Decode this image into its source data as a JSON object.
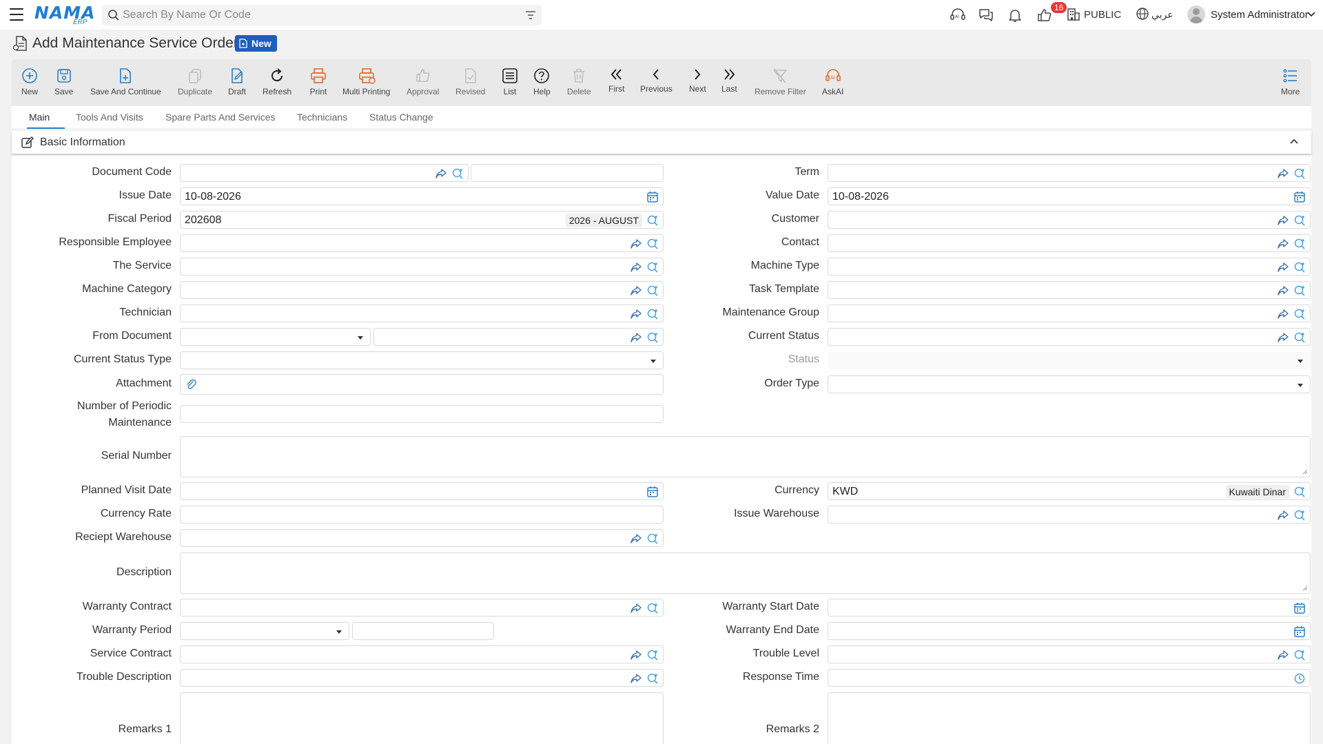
{
  "topbar": {
    "logo_text": "NAMA",
    "logo_sub": "ERP",
    "search_placeholder": "Search By Name Or Code",
    "notification_count": "16",
    "public_label": "PUBLIC",
    "language_label": "عربي",
    "user_name": "System Administrator"
  },
  "page": {
    "title": "Add Maintenance Service Order",
    "status_badge": "New"
  },
  "toolbar": {
    "new": "New",
    "save": "Save",
    "save_continue": "Save And Continue",
    "duplicate": "Duplicate",
    "draft": "Draft",
    "refresh": "Refresh",
    "print": "Print",
    "multi_printing": "Multi Printing",
    "approval": "Approval",
    "revised": "Revised",
    "list": "List",
    "help": "Help",
    "delete": "Delete",
    "first": "First",
    "previous": "Previous",
    "next": "Next",
    "last": "Last",
    "remove_filter": "Remove Filter",
    "askai": "AskAI",
    "more": "More"
  },
  "tabs": [
    "Main",
    "Tools And Visits",
    "Spare Parts And Services",
    "Technicians",
    "Status Change"
  ],
  "section": {
    "title": "Basic Information"
  },
  "form": {
    "labels": {
      "document_code": "Document Code",
      "issue_date": "Issue Date",
      "fiscal_period": "Fiscal Period",
      "responsible_employee": "Responsible Employee",
      "the_service": "The Service",
      "machine_category": "Machine Category",
      "technician": "Technician",
      "from_document": "From Document",
      "current_status_type": "Current Status Type",
      "attachment": "Attachment",
      "number_periodic_1": "Number of Periodic",
      "number_periodic_2": "Maintenance",
      "serial_number": "Serial Number",
      "planned_visit_date": "Planned Visit Date",
      "currency_rate": "Currency Rate",
      "receipt_warehouse": "Reciept Warehouse",
      "description": "Description",
      "warranty_contract": "Warranty Contract",
      "warranty_period": "Warranty Period",
      "service_contract": "Service Contract",
      "trouble_description": "Trouble Description",
      "remarks1": "Remarks 1",
      "term": "Term",
      "value_date": "Value Date",
      "customer": "Customer",
      "contact": "Contact",
      "machine_type": "Machine Type",
      "task_template": "Task Template",
      "maintenance_group": "Maintenance Group",
      "current_status": "Current Status",
      "status": "Status",
      "order_type": "Order Type",
      "currency": "Currency",
      "issue_warehouse": "Issue Warehouse",
      "warranty_start_date": "Warranty Start Date",
      "warranty_end_date": "Warranty End Date",
      "trouble_level": "Trouble Level",
      "response_time": "Response Time",
      "remarks2": "Remarks 2"
    },
    "values": {
      "issue_date": "10-08-2026",
      "value_date": "10-08-2026",
      "fiscal_period": "202608",
      "fiscal_period_name": "2026 - AUGUST",
      "currency": "KWD",
      "currency_name": "Kuwaiti Dinar"
    },
    "colors": {
      "accent": "#1d7ed6",
      "print": "#e8662a",
      "badge": "#1e5dbe"
    }
  }
}
